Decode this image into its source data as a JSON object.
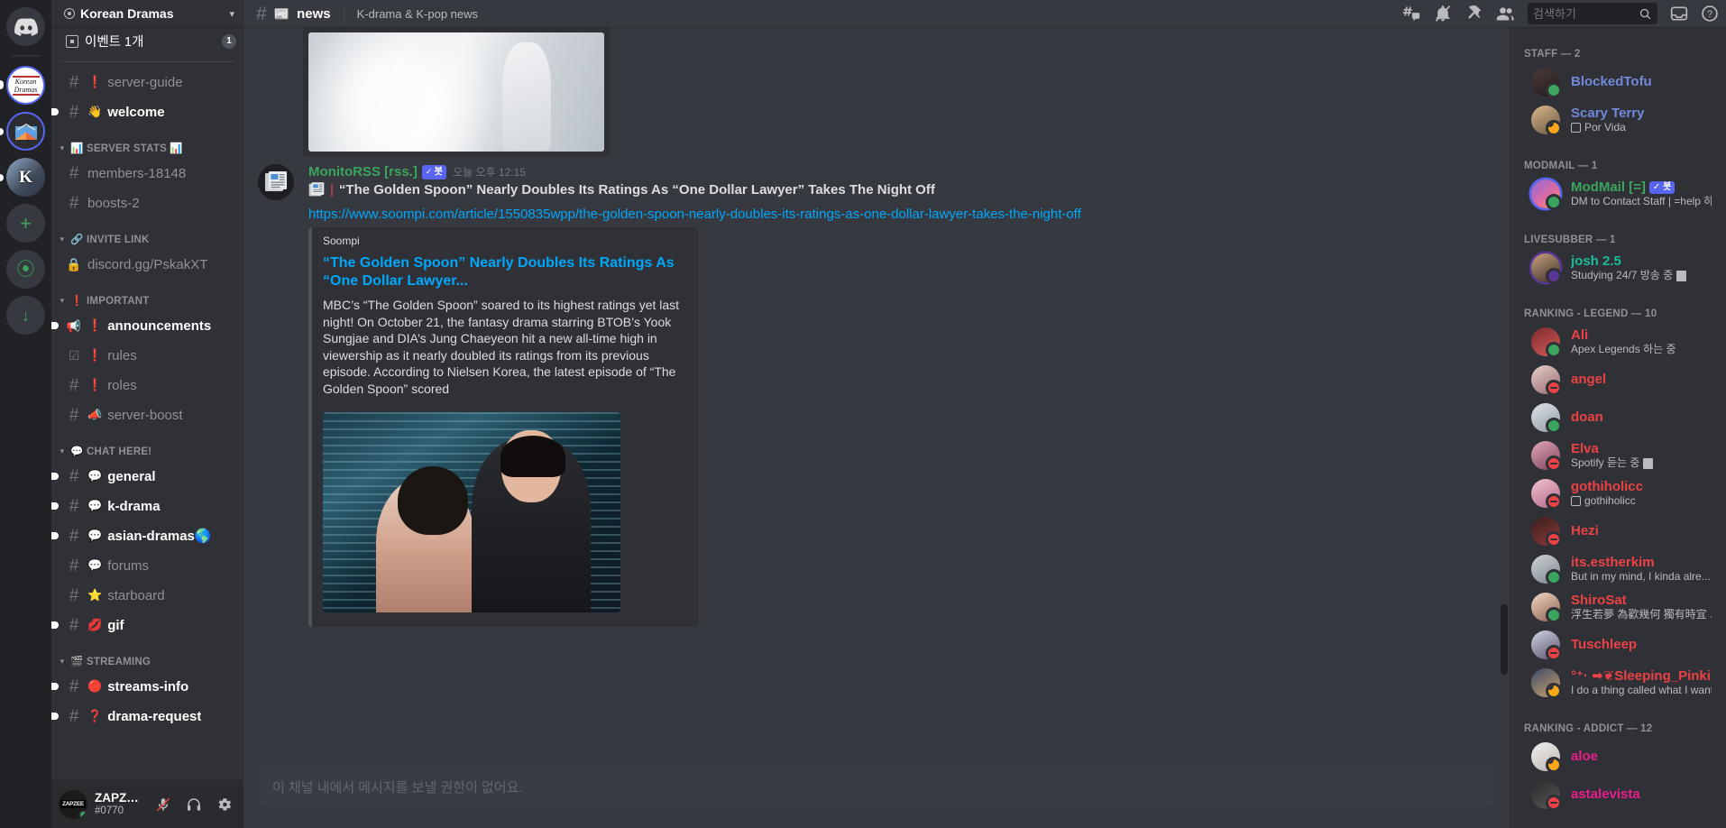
{
  "rail": {
    "items": [
      {
        "name": "home",
        "label": "Discord Home"
      },
      {
        "name": "korean-dramas",
        "label": "Korean Dramas",
        "line1": "Korean",
        "line2": "Dramas"
      },
      {
        "name": "mail-server",
        "label": "Mail Server"
      },
      {
        "name": "k-server",
        "label": "K",
        "letter": "K"
      },
      {
        "name": "add-server",
        "label": "+"
      },
      {
        "name": "explore",
        "label": "⦿"
      },
      {
        "name": "download",
        "label": "↓"
      }
    ]
  },
  "sidebar": {
    "server_name": "Korean Dramas",
    "event": {
      "label": "이벤트 1개",
      "count": "1"
    },
    "groups": [
      {
        "id": "top",
        "label": null,
        "channels": [
          {
            "hash": "#",
            "emoji": "❗",
            "name": "server-guide",
            "unread": false
          },
          {
            "hash": "#",
            "emoji": "👋",
            "name": "welcome",
            "unread": true
          }
        ]
      },
      {
        "id": "server-stats",
        "label": "📊 SERVER STATS 📊",
        "channels": [
          {
            "hash": "#",
            "emoji": "",
            "name": "members-18148",
            "unread": false
          },
          {
            "hash": "#",
            "emoji": "",
            "name": "boosts-2",
            "unread": false
          }
        ]
      },
      {
        "id": "invite-link",
        "label": "🔗 INVITE LINK",
        "channels": [
          {
            "hash": "🔒",
            "emoji": "",
            "name": "discord.gg/PskakXT",
            "unread": false
          }
        ]
      },
      {
        "id": "important",
        "label": "❗ IMPORTANT",
        "channels": [
          {
            "hash": "📢",
            "emoji": "❗",
            "name": "announcements",
            "unread": true
          },
          {
            "hash": "☑",
            "emoji": "❗",
            "name": "rules",
            "unread": false
          },
          {
            "hash": "#",
            "emoji": "❗",
            "name": "roles",
            "unread": false
          },
          {
            "hash": "#",
            "emoji": "📣",
            "name": "server-boost",
            "unread": false
          }
        ]
      },
      {
        "id": "chat-here",
        "label": "💬 CHAT HERE!",
        "channels": [
          {
            "hash": "#",
            "emoji": "💬",
            "name": "general",
            "unread": true
          },
          {
            "hash": "#",
            "emoji": "💬",
            "name": "k-drama",
            "unread": true
          },
          {
            "hash": "#",
            "emoji": "💬",
            "name": "asian-dramas🌎",
            "unread": true
          },
          {
            "hash": "#",
            "emoji": "💬",
            "name": "forums",
            "unread": false
          },
          {
            "hash": "#",
            "emoji": "⭐",
            "name": "starboard",
            "unread": false
          },
          {
            "hash": "#",
            "emoji": "💋",
            "name": "gif",
            "unread": true
          }
        ]
      },
      {
        "id": "streaming",
        "label": "🎬 STREAMING",
        "channels": [
          {
            "hash": "#",
            "emoji": "🔴",
            "name": "streams-info",
            "unread": true
          },
          {
            "hash": "#",
            "emoji": "❓",
            "name": "drama-request",
            "unread": true
          }
        ]
      }
    ],
    "user": {
      "name": "ZAPZEE_N...",
      "tag": "#0770",
      "avatar_text": "ZAPZEE"
    }
  },
  "topbar": {
    "hash": "#",
    "channel_emoji": "📰",
    "channel_name": "news",
    "topic": "K-drama & K-pop news",
    "icons": [
      "threads-icon",
      "bell-off-icon",
      "pin-icon",
      "members-icon"
    ],
    "search": {
      "placeholder": "검색하기",
      "value": ""
    },
    "inbox_label": "inbox-icon",
    "help_label": "help-icon"
  },
  "message": {
    "author": "MonitoRSS [rss.]",
    "bot_tag": "봇",
    "bot_check": "✓",
    "timestamp": "오늘 오후 12:15",
    "avatar_icon": "newspaper-icon",
    "line_emoji": "📰",
    "line_separator": "|",
    "headline": "“The Golden Spoon” Nearly Doubles Its Ratings As “One Dollar Lawyer” Takes The Night Off",
    "link": "https://www.soompi.com/article/1550835wpp/the-golden-spoon-nearly-doubles-its-ratings-as-one-dollar-lawyer-takes-the-night-off",
    "embed": {
      "provider": "Soompi",
      "title": "“The Golden Spoon” Nearly Doubles Its Ratings As “One Dollar Lawyer...",
      "description": "MBC’s “The Golden Spoon” soared to its highest ratings yet last night! On October 21, the fantasy drama starring BTOB’s Yook Sungjae and DIA’s Jung Chaeyeon hit a new all-time high in viewership as it nearly doubled its ratings from its previous episode. According to Nielsen Korea, the latest episode of “The Golden Spoon” scored"
    }
  },
  "composer": {
    "placeholder": "이 채널 내에서 메시지를 보낼 권한이 없어요."
  },
  "members": {
    "groups": [
      {
        "label": "STAFF — 2",
        "members": [
          {
            "name": "BlockedTofu",
            "color": "#7289da",
            "status": "online",
            "sub": "",
            "avatar": "ava-a"
          },
          {
            "name": "Scary Terry",
            "color": "#7289da",
            "status": "idle",
            "sub": "Por Vida",
            "sub_icon": "spotify-icon",
            "avatar": "ava-b"
          }
        ]
      },
      {
        "label": "MODMAIL — 1",
        "members": [
          {
            "name": "ModMail [=]",
            "color": "#3ba55d",
            "status": "online",
            "badge": "✓ 봇",
            "sub": "DM to Contact Staff | =help 하...",
            "avatar": "ava-c",
            "ring": "ring"
          }
        ]
      },
      {
        "label": "LIVESUBBER — 1",
        "members": [
          {
            "name": "josh 2.5",
            "color": "#1abc9c",
            "status": "streaming",
            "sub": "Studying 24/7 방송 중",
            "sub_icon": "doc-icon",
            "avatar": "ava-d",
            "ring": "ringp"
          }
        ]
      },
      {
        "label": "RANKING - LEGEND — 10",
        "members": [
          {
            "name": "Ali",
            "color": "#ed4245",
            "status": "online",
            "sub": "Apex Legends 하는 중",
            "avatar": "ava-e"
          },
          {
            "name": "angel",
            "color": "#ed4245",
            "status": "dnd",
            "sub": "",
            "avatar": "ava-f"
          },
          {
            "name": "doan",
            "color": "#ed4245",
            "status": "online",
            "sub": "",
            "avatar": "ava-g"
          },
          {
            "name": "Elva",
            "color": "#ed4245",
            "status": "dnd",
            "sub": "Spotify 듣는 중",
            "sub_icon": "doc-icon",
            "avatar": "ava-h"
          },
          {
            "name": "gothiholicc",
            "color": "#ed4245",
            "status": "dnd",
            "sub": "gothiholicc",
            "sub_icon": "square-icon",
            "avatar": "ava-i"
          },
          {
            "name": "Hezi",
            "color": "#ed4245",
            "status": "dnd",
            "sub": "",
            "avatar": "ava-j"
          },
          {
            "name": "its.estherkim",
            "color": "#ed4245",
            "status": "online",
            "sub": "But in my mind, I kinda alre...",
            "sub_icon": "doc-icon",
            "avatar": "ava-k"
          },
          {
            "name": "ShiroSat",
            "color": "#ed4245",
            "status": "online",
            "sub": "浮生若夢 為歡幾何 獨有時宜 ...",
            "avatar": "ava-l"
          },
          {
            "name": "Tuschleep",
            "color": "#ed4245",
            "status": "dnd",
            "sub": "",
            "avatar": "ava-m"
          },
          {
            "name": "°⁺· ➡❦Sleeping_Pinki...",
            "color": "#ed4245",
            "status": "idle",
            "sub": "I do a thing called what I want ...",
            "avatar": "ava-n"
          }
        ]
      },
      {
        "label": "RANKING - ADDICT — 12",
        "members": [
          {
            "name": "aloe",
            "color": "#e91e8c",
            "status": "idle",
            "sub": "",
            "avatar": "ava-o"
          },
          {
            "name": "astalevista",
            "color": "#e91e8c",
            "status": "dnd",
            "sub": "",
            "avatar": "ava-p"
          }
        ]
      }
    ]
  }
}
